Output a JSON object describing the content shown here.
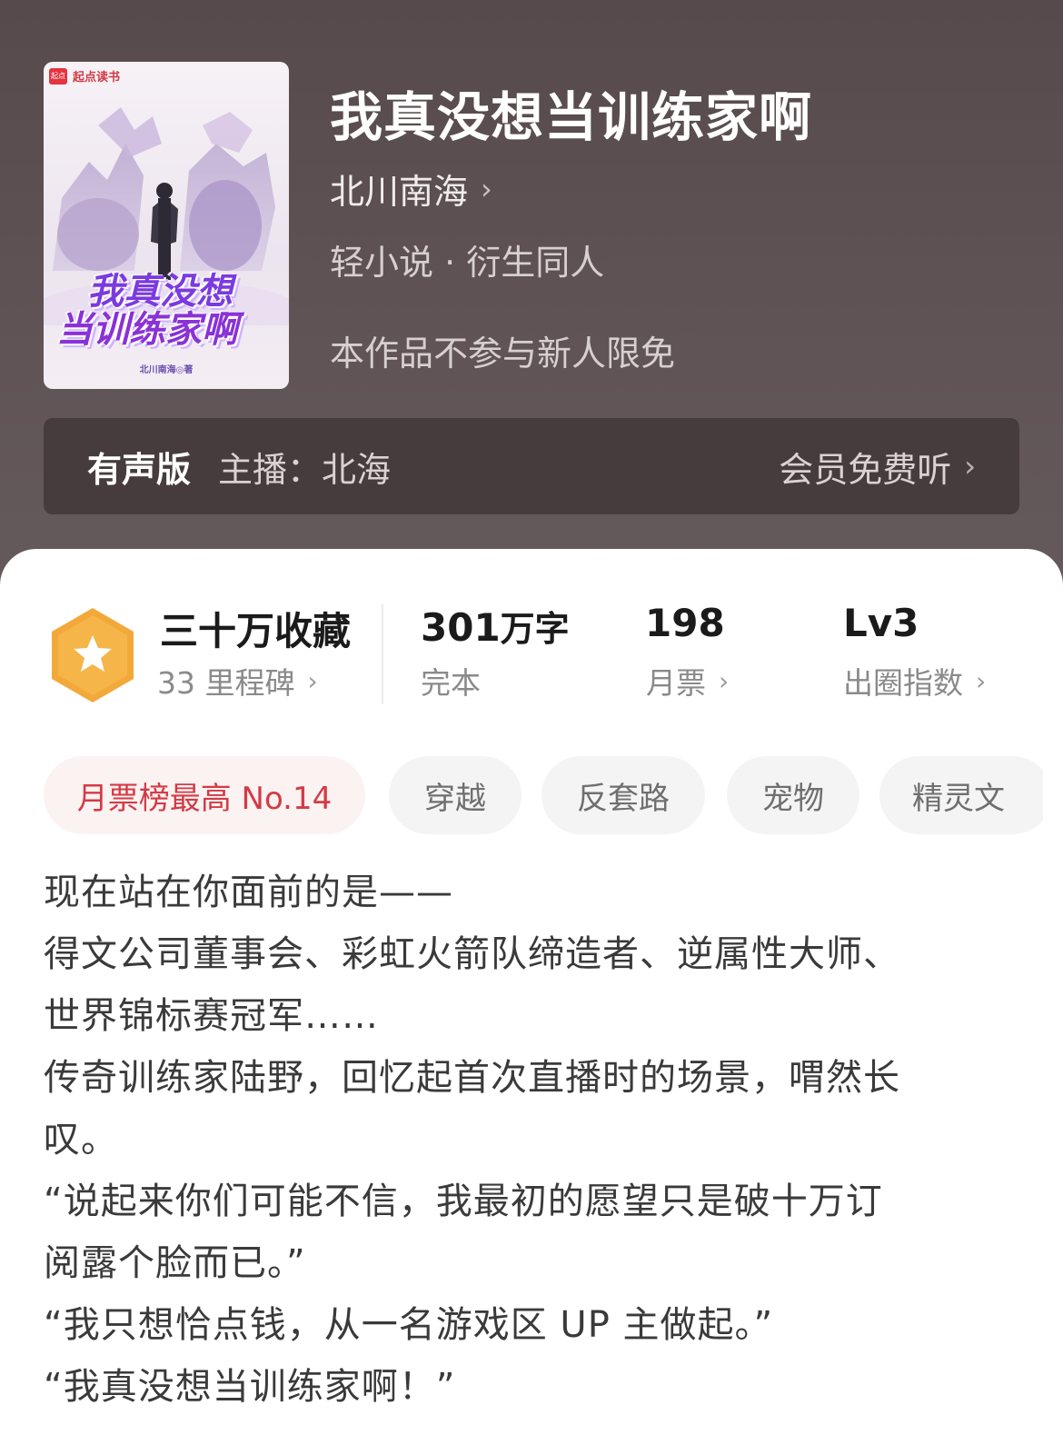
{
  "book": {
    "title": "我真没想当训练家啊",
    "author": "北川南海",
    "genre": "轻小说 · 衍生同人",
    "notice": "本作品不参与新人限免",
    "cover": {
      "brand_logo": "起点",
      "brand": "起点读书",
      "title_line1": "我真没想",
      "title_line2": "当训练家啊",
      "author_credit": "北川南海◎著"
    }
  },
  "audio": {
    "label": "有声版",
    "narrator": "主播：北海",
    "listen": "会员免费听"
  },
  "stats": {
    "collection": "三十万收藏",
    "milestones": "33 里程碑",
    "word_count": "301",
    "word_unit": "万字",
    "status": "完本",
    "monthly_tickets": "198",
    "monthly_label": "月票",
    "level": "Lv3",
    "level_label": "出圈指数"
  },
  "tags": [
    "月票榜最高 No.14",
    "穿越",
    "反套路",
    "宠物",
    "精灵文"
  ],
  "description": [
    "现在站在你面前的是——",
    "得文公司董事会、彩虹火箭队缔造者、逆属性大师、",
    "世界锦标赛冠军……",
    "传奇训练家陆野，回忆起首次直播时的场景，喟然长",
    "叹。",
    "“说起来你们可能不信，我最初的愿望只是破十万订",
    "阅露个脸而已。”",
    "“我只想恰点钱，从一名游戏区 UP 主做起。”",
    "“我真没想当训练家啊！”"
  ],
  "icons": {
    "chevron": "chevron-right-icon",
    "badge": "star-hexagon-icon"
  },
  "colors": {
    "header_bg": "#564a4c",
    "audio_bar_bg": "#463c3e",
    "hot_tag_text": "#d33b46",
    "badge_orange": "#f5a623"
  }
}
